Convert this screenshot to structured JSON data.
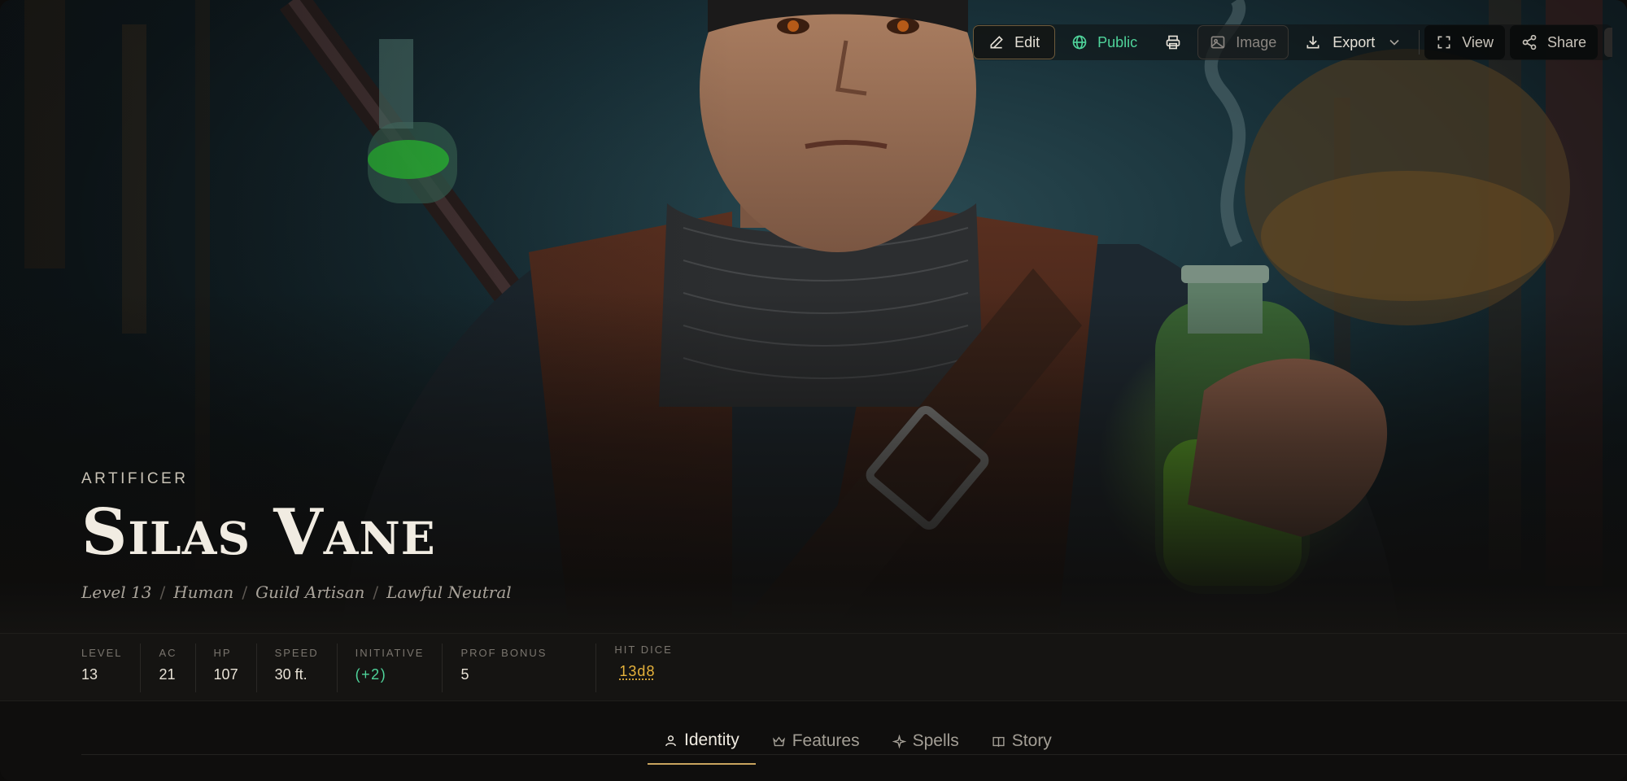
{
  "toolbar": {
    "edit_label": "Edit",
    "public_label": "Public",
    "image_label": "Image",
    "export_label": "Export",
    "view_label": "View",
    "share_label": "Share"
  },
  "character": {
    "class": "ARTIFICER",
    "name": "Silas Vane",
    "subline": [
      "Level 13",
      "Human",
      "Guild Artisan",
      "Lawful Neutral"
    ],
    "separator": "/"
  },
  "stats": [
    {
      "label": "LEVEL",
      "value": "13"
    },
    {
      "label": "AC",
      "value": "21"
    },
    {
      "label": "HP",
      "value": "107"
    },
    {
      "label": "SPEED",
      "value": "30 ft."
    },
    {
      "label": "INITIATIVE",
      "value": "(+2)"
    },
    {
      "label": "PROF BONUS",
      "value": "5"
    },
    {
      "label": "HIT DICE",
      "value": "13d8"
    }
  ],
  "tabs": [
    {
      "label": "Identity",
      "icon": "person-icon",
      "active": true
    },
    {
      "label": "Features",
      "icon": "crown-icon",
      "active": false
    },
    {
      "label": "Spells",
      "icon": "sparkle-icon",
      "active": false
    },
    {
      "label": "Story",
      "icon": "book-icon",
      "active": false
    }
  ],
  "colors": {
    "accent_green": "#4fd39a",
    "accent_gold": "#e6b23b",
    "tab_underline": "#c9a45e"
  }
}
